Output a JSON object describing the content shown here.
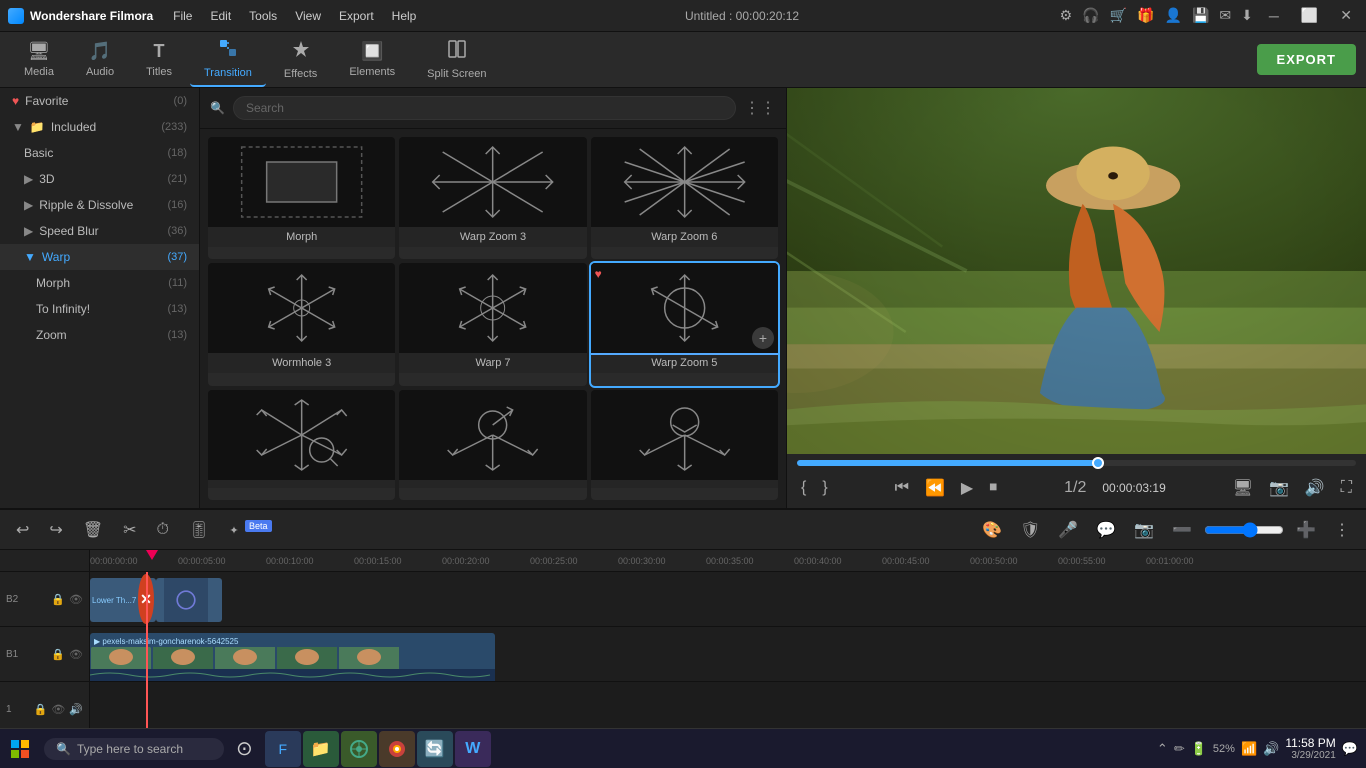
{
  "app": {
    "name": "Wondershare Filmora",
    "title": "Untitled : 00:00:20:12"
  },
  "menu": {
    "items": [
      "File",
      "Edit",
      "Tools",
      "View",
      "Export",
      "Help"
    ]
  },
  "toolbar": {
    "items": [
      {
        "id": "media",
        "label": "Media",
        "icon": "🖥"
      },
      {
        "id": "audio",
        "label": "Audio",
        "icon": "🎵"
      },
      {
        "id": "titles",
        "label": "Titles",
        "icon": "T"
      },
      {
        "id": "transition",
        "label": "Transition",
        "icon": "⬡"
      },
      {
        "id": "effects",
        "label": "Effects",
        "icon": "⚡"
      },
      {
        "id": "elements",
        "label": "Elements",
        "icon": "🔲"
      },
      {
        "id": "split-screen",
        "label": "Split Screen",
        "icon": "⊞"
      }
    ],
    "active": "transition",
    "export_label": "EXPORT"
  },
  "left_panel": {
    "sections": [
      {
        "label": "Favorite",
        "count": "(0)",
        "icon": "♥",
        "level": 0
      },
      {
        "label": "Included",
        "count": "(233)",
        "icon": "📁",
        "level": 0,
        "expanded": true
      },
      {
        "label": "Basic",
        "count": "(18)",
        "level": 1
      },
      {
        "label": "3D",
        "count": "(21)",
        "level": 1
      },
      {
        "label": "Ripple & Dissolve",
        "count": "(16)",
        "level": 1
      },
      {
        "label": "Speed Blur",
        "count": "(36)",
        "level": 1
      },
      {
        "label": "Warp",
        "count": "(37)",
        "level": 1,
        "active": true
      },
      {
        "label": "Morph",
        "count": "(11)",
        "level": 2
      },
      {
        "label": "To Infinity!",
        "count": "(13)",
        "level": 2
      },
      {
        "label": "Zoom",
        "count": "(13)",
        "level": 2
      }
    ]
  },
  "search": {
    "placeholder": "Search"
  },
  "transitions": [
    {
      "id": 1,
      "name": "Morph",
      "type": "morph"
    },
    {
      "id": 2,
      "name": "Warp Zoom 3",
      "type": "warp-zoom"
    },
    {
      "id": 3,
      "name": "Warp Zoom 6",
      "type": "warp-zoom"
    },
    {
      "id": 4,
      "name": "Wormhole 3",
      "type": "wormhole"
    },
    {
      "id": 5,
      "name": "Warp 7",
      "type": "warp"
    },
    {
      "id": 6,
      "name": "Warp Zoom 5",
      "type": "warp-zoom",
      "selected": true,
      "fav": true
    },
    {
      "id": 7,
      "name": "",
      "type": "warp-zoom-alt"
    },
    {
      "id": 8,
      "name": "",
      "type": "warp-zoom-alt2"
    },
    {
      "id": 9,
      "name": "",
      "type": "warp-zoom-alt3"
    }
  ],
  "preview": {
    "time_current": "00:00:03:19",
    "playback_ratio": "1/2",
    "progress_pct": 55
  },
  "timeline": {
    "ruler_marks": [
      "00:00:00:00",
      "00:00:05:00",
      "00:00:10:00",
      "00:00:15:00",
      "00:00:20:00",
      "00:00:25:00",
      "00:00:30:00",
      "00:00:35:00",
      "00:00:40:00",
      "00:00:45:00",
      "00:00:50:00",
      "00:00:55:00",
      "00:01:00:00"
    ],
    "playhead_pos": "00:00:02:00",
    "tracks": [
      {
        "id": "B2",
        "type": "transition",
        "label": "Lower Th...7"
      },
      {
        "id": "B1",
        "type": "video",
        "label": "pexels-maksim-goncharenok-5642525"
      }
    ]
  },
  "taskbar": {
    "search_placeholder": "Type here to search",
    "clock_time": "11:58 PM",
    "clock_date": "3/29/2021",
    "battery_pct": "52%"
  }
}
